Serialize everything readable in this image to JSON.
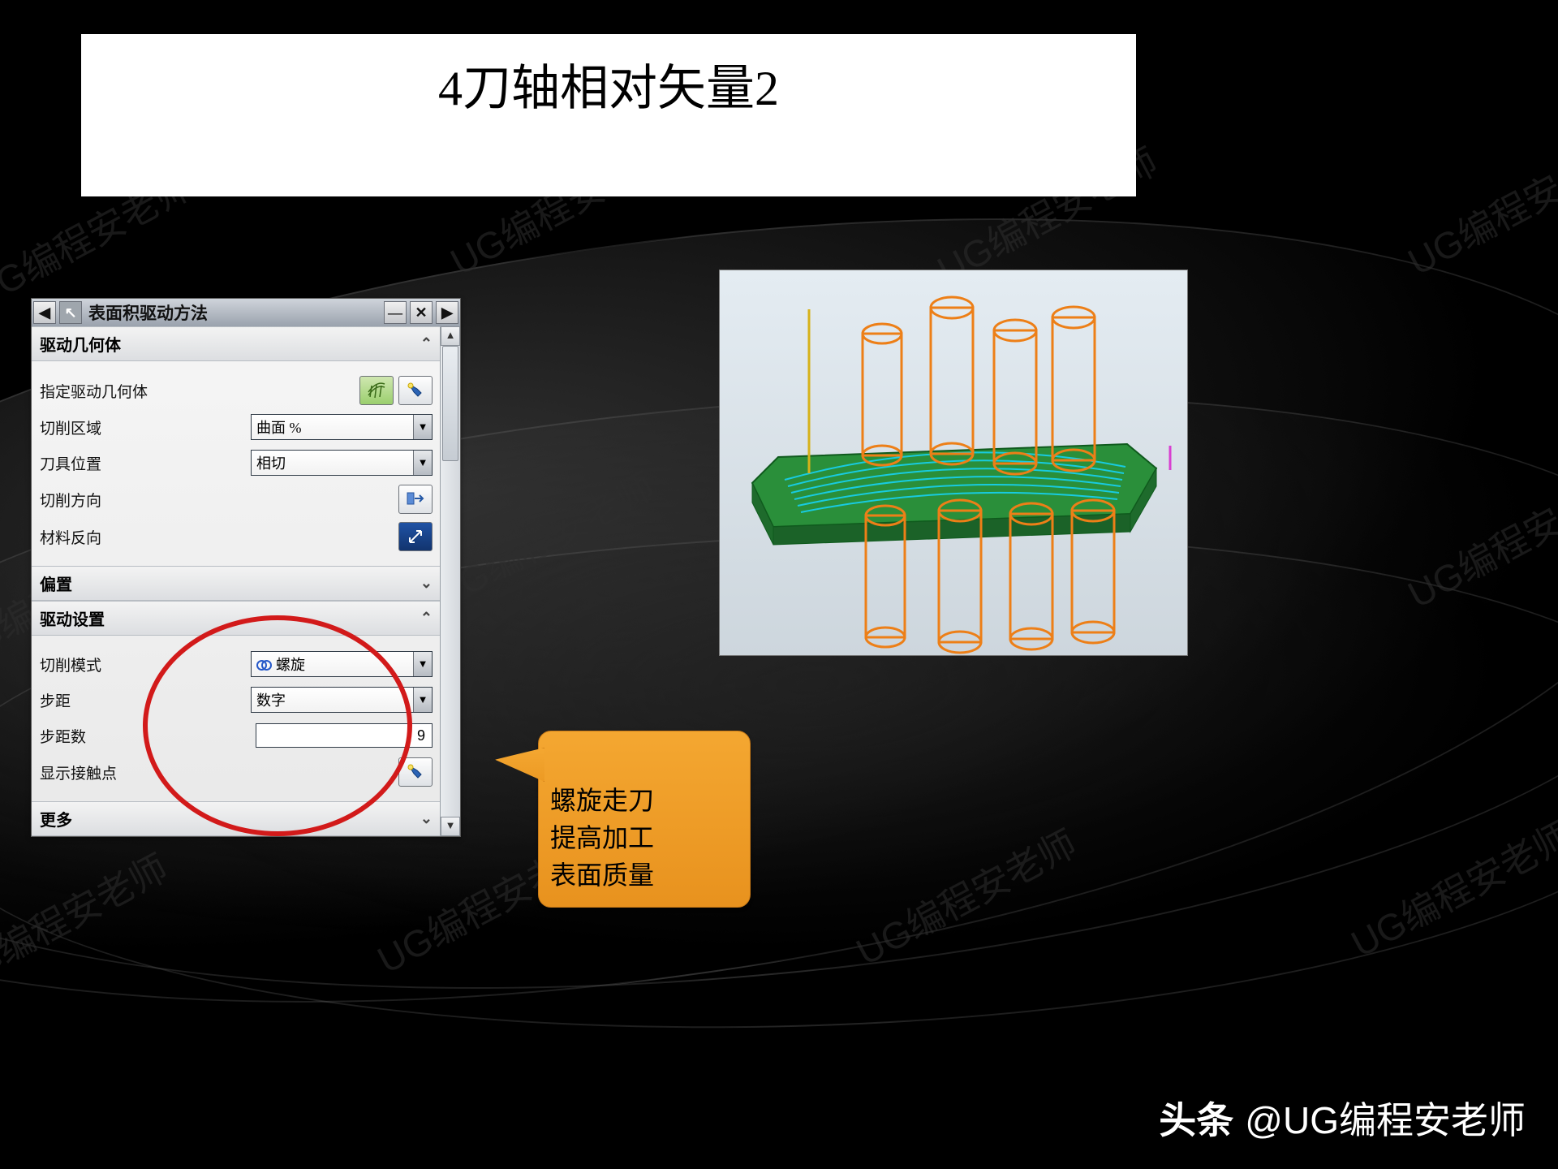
{
  "title": "4刀轴相对矢量2",
  "dialog": {
    "title": "表面积驱动方法",
    "sections": {
      "drive_geom": {
        "header": "驱动几何体",
        "rows": {
          "specify_drive_geom": "指定驱动几何体",
          "cut_region": {
            "label": "切削区域",
            "value": "曲面 %"
          },
          "tool_position": {
            "label": "刀具位置",
            "value": "相切"
          },
          "cut_direction": "切削方向",
          "material_reverse": "材料反向"
        }
      },
      "offset": {
        "header": "偏置"
      },
      "drive_settings": {
        "header": "驱动设置",
        "rows": {
          "cut_mode": {
            "label": "切削模式",
            "value": "螺旋"
          },
          "step": {
            "label": "步距",
            "value": "数字"
          },
          "step_count": {
            "label": "步距数",
            "value": "9"
          },
          "show_contact": "显示接触点"
        }
      },
      "more": {
        "header": "更多"
      }
    }
  },
  "callout": "螺旋走刀\n提高加工\n表面质量",
  "watermark": "UG编程安老师",
  "footer": {
    "brand": "头条",
    "handle": "@UG编程安老师"
  }
}
